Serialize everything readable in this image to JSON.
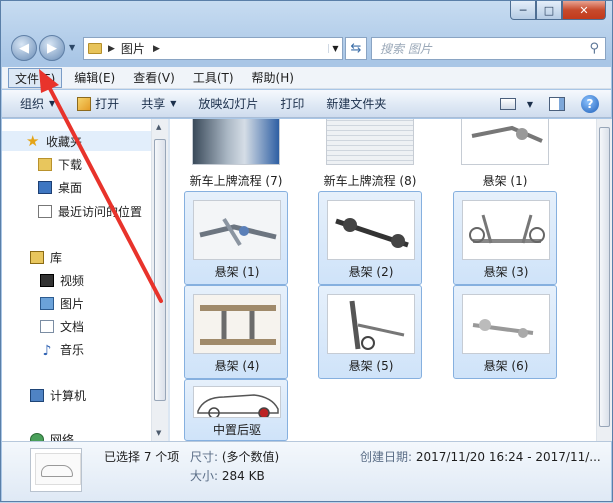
{
  "window": {
    "caption": {
      "min": "─",
      "max": "□",
      "close": "✕"
    }
  },
  "address": {
    "path_sep": "▶",
    "folder": "图片",
    "search_placeholder": "搜索 图片"
  },
  "menu": [
    "文件(F)",
    "编辑(E)",
    "查看(V)",
    "工具(T)",
    "帮助(H)"
  ],
  "toolbar": {
    "organize": "组织",
    "open": "打开",
    "share": "共享",
    "slideshow": "放映幻灯片",
    "print": "打印",
    "new_folder": "新建文件夹",
    "help": "?"
  },
  "navpane": {
    "favorites": "收藏夹",
    "downloads": "下载",
    "desktop": "桌面",
    "recent": "最近访问的位置",
    "libraries": "库",
    "videos": "视频",
    "pictures": "图片",
    "documents": "文档",
    "music": "音乐",
    "computer": "计算机",
    "network": "网络"
  },
  "files": [
    {
      "name": "新车上牌流程 (7)",
      "selected": false
    },
    {
      "name": "新车上牌流程 (8)",
      "selected": false
    },
    {
      "name": "悬架 (1)",
      "selected": false
    },
    {
      "name": "悬架 (1)",
      "selected": true
    },
    {
      "name": "悬架 (2)",
      "selected": true
    },
    {
      "name": "悬架 (3)",
      "selected": true
    },
    {
      "name": "悬架 (4)",
      "selected": true
    },
    {
      "name": "悬架 (5)",
      "selected": true
    },
    {
      "name": "悬架 (6)",
      "selected": true
    },
    {
      "name": "中置后驱",
      "selected": true
    }
  ],
  "details": {
    "selected_count": "已选择 7 个项",
    "size_key": "尺寸:",
    "size_val": "(多个数值)",
    "filesize_key": "大小:",
    "filesize_val": "284 KB",
    "created_key": "创建日期:",
    "created_val": "2017/11/20 16:24 - 2017/11/..."
  },
  "colors": {
    "annotation_arrow": "#e8332b",
    "selection": "#cfe3f9"
  }
}
